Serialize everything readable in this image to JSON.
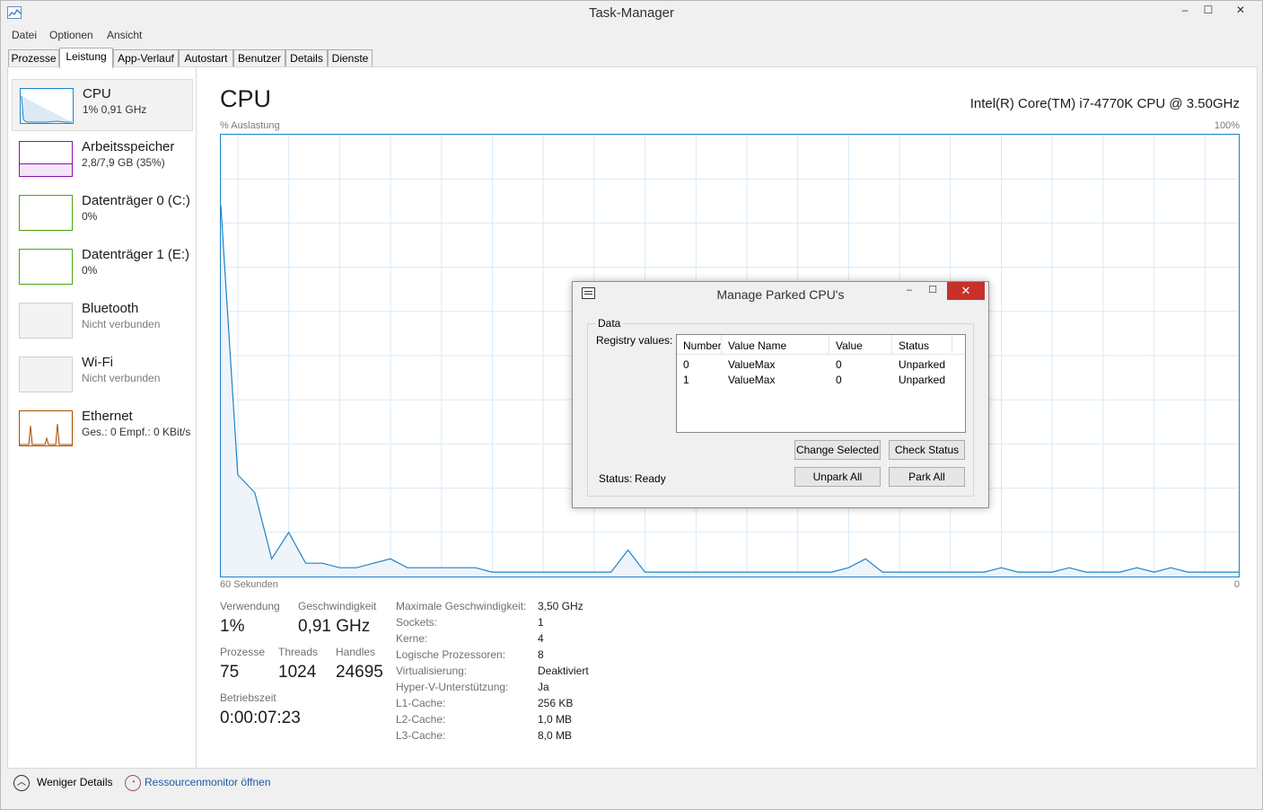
{
  "window": {
    "title": "Task-Manager",
    "controls": {
      "minimize": "–",
      "maximize": "☐",
      "close": "✕"
    }
  },
  "menu": [
    "Datei",
    "Optionen",
    "Ansicht"
  ],
  "tabs": [
    "Prozesse",
    "Leistung",
    "App-Verlauf",
    "Autostart",
    "Benutzer",
    "Details",
    "Dienste"
  ],
  "active_tab": "Leistung",
  "sidebar": {
    "items": [
      {
        "title": "CPU",
        "sub": "1% 0,91 GHz",
        "color": "#1d84c8"
      },
      {
        "title": "Arbeitsspeicher",
        "sub": "2,8/7,9 GB (35%)",
        "color": "#8b12ae"
      },
      {
        "title": "Datenträger 0 (C:)",
        "sub": "0%",
        "color": "#4da60c"
      },
      {
        "title": "Datenträger 1 (E:)",
        "sub": "0%",
        "color": "#4da60c"
      },
      {
        "title": "Bluetooth",
        "sub": "Nicht verbunden",
        "color": "#999999"
      },
      {
        "title": "Wi-Fi",
        "sub": "Nicht verbunden",
        "color": "#999999"
      },
      {
        "title": "Ethernet",
        "sub": "Ges.: 0 Empf.: 0 KBit/s",
        "color": "#a74f01"
      }
    ]
  },
  "main": {
    "title": "CPU",
    "model": "Intel(R) Core(TM) i7-4770K CPU @ 3.50GHz",
    "graph": {
      "y_label": "% Auslastung",
      "y_max_label": "100%",
      "x_label": "60 Sekunden",
      "x_min_label": "0",
      "color": "#1d84c8"
    },
    "stats": {
      "usage_label": "Verwendung",
      "usage": "1%",
      "speed_label": "Geschwindigkeit",
      "speed": "0,91 GHz",
      "processes_label": "Prozesse",
      "processes": "75",
      "threads_label": "Threads",
      "threads": "1024",
      "handles_label": "Handles",
      "handles": "24695",
      "uptime_label": "Betriebszeit",
      "uptime": "0:00:07:23"
    },
    "specs": [
      {
        "label": "Maximale Geschwindigkeit:",
        "value": "3,50 GHz"
      },
      {
        "label": "Sockets:",
        "value": "1"
      },
      {
        "label": "Kerne:",
        "value": "4"
      },
      {
        "label": "Logische Prozessoren:",
        "value": "8"
      },
      {
        "label": "Virtualisierung:",
        "value": "Deaktiviert"
      },
      {
        "label": "Hyper-V-Unterstützung:",
        "value": "Ja"
      },
      {
        "label": "L1-Cache:",
        "value": "256 KB"
      },
      {
        "label": "L2-Cache:",
        "value": "1,0 MB"
      },
      {
        "label": "L3-Cache:",
        "value": "8,0 MB"
      }
    ]
  },
  "footer": {
    "less_details": "Weniger Details",
    "resmon": "Ressourcenmonitor öffnen"
  },
  "dialog": {
    "title": "Manage Parked CPU's",
    "group": "Data",
    "registry_label": "Registry values:",
    "columns": [
      "Number",
      "Value Name",
      "Value",
      "Status"
    ],
    "rows": [
      {
        "number": "0",
        "name": "ValueMax",
        "value": "0",
        "status": "Unparked"
      },
      {
        "number": "1",
        "name": "ValueMax",
        "value": "0",
        "status": "Unparked"
      }
    ],
    "buttons": {
      "change_selected": "Change Selected",
      "check_status": "Check Status",
      "unpark_all": "Unpark All",
      "park_all": "Park All"
    },
    "status_label": "Status:",
    "status_value": "Ready"
  },
  "chart_data": {
    "type": "area",
    "x": [
      60,
      59,
      58,
      57,
      56,
      55,
      54,
      53,
      52,
      51,
      50,
      49,
      48,
      47,
      46,
      45,
      44,
      43,
      42,
      41,
      40,
      39,
      38,
      37,
      36,
      35,
      34,
      33,
      32,
      31,
      30,
      29,
      28,
      27,
      26,
      25,
      24,
      23,
      22,
      21,
      20,
      19,
      18,
      17,
      16,
      15,
      14,
      13,
      12,
      11,
      10,
      9,
      8,
      7,
      6,
      5,
      4,
      3,
      2,
      1,
      0
    ],
    "values": [
      84,
      23,
      19,
      4,
      10,
      3,
      3,
      2,
      2,
      3,
      4,
      2,
      2,
      2,
      2,
      2,
      1,
      1,
      1,
      1,
      1,
      1,
      1,
      1,
      6,
      1,
      1,
      1,
      1,
      1,
      1,
      1,
      1,
      1,
      1,
      1,
      1,
      2,
      4,
      1,
      1,
      1,
      1,
      1,
      1,
      1,
      2,
      1,
      1,
      1,
      2,
      1,
      1,
      1,
      2,
      1,
      2,
      1,
      1,
      1,
      1
    ],
    "ylim": [
      0,
      100
    ],
    "xlim": [
      60,
      0
    ],
    "grid": true
  }
}
